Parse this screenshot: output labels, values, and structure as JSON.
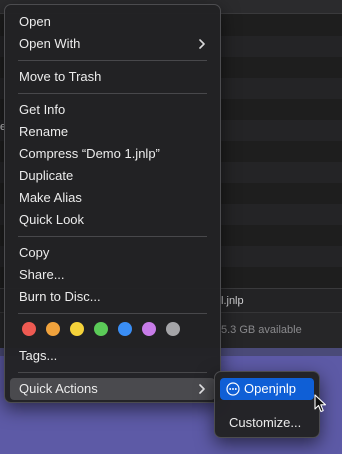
{
  "finder": {
    "filename_fragment": "l.jnlp",
    "storage_fragment": "5.3 GB available",
    "edge_char": "e"
  },
  "context_menu": {
    "group1": [
      {
        "label": "Open"
      },
      {
        "label": "Open With",
        "submenu": true
      }
    ],
    "group2": [
      {
        "label": "Move to Trash"
      }
    ],
    "group3": [
      {
        "label": "Get Info"
      },
      {
        "label": "Rename"
      },
      {
        "label": "Compress “Demo 1.jnlp”"
      },
      {
        "label": "Duplicate"
      },
      {
        "label": "Make Alias"
      },
      {
        "label": "Quick Look"
      }
    ],
    "group4": [
      {
        "label": "Copy"
      },
      {
        "label": "Share..."
      },
      {
        "label": "Burn to Disc..."
      }
    ],
    "tag_colors": [
      {
        "name": "red",
        "color": "#ee5a52"
      },
      {
        "name": "orange",
        "color": "#f0a23c"
      },
      {
        "name": "yellow",
        "color": "#f5d23a"
      },
      {
        "name": "green",
        "color": "#5bcb58"
      },
      {
        "name": "blue",
        "color": "#3a8ef5"
      },
      {
        "name": "purple",
        "color": "#c77ce8"
      },
      {
        "name": "gray",
        "color": "#a5a5a8"
      }
    ],
    "tags_label": "Tags...",
    "quick_actions_label": "Quick Actions"
  },
  "submenu": {
    "primary": {
      "label": "Openjnlp",
      "icon": "ellipsis-circle-icon"
    },
    "customize": "Customize..."
  },
  "colors": {
    "highlight_blue": "#0f5fd6",
    "desktop_purple": "#5d5aa6"
  }
}
